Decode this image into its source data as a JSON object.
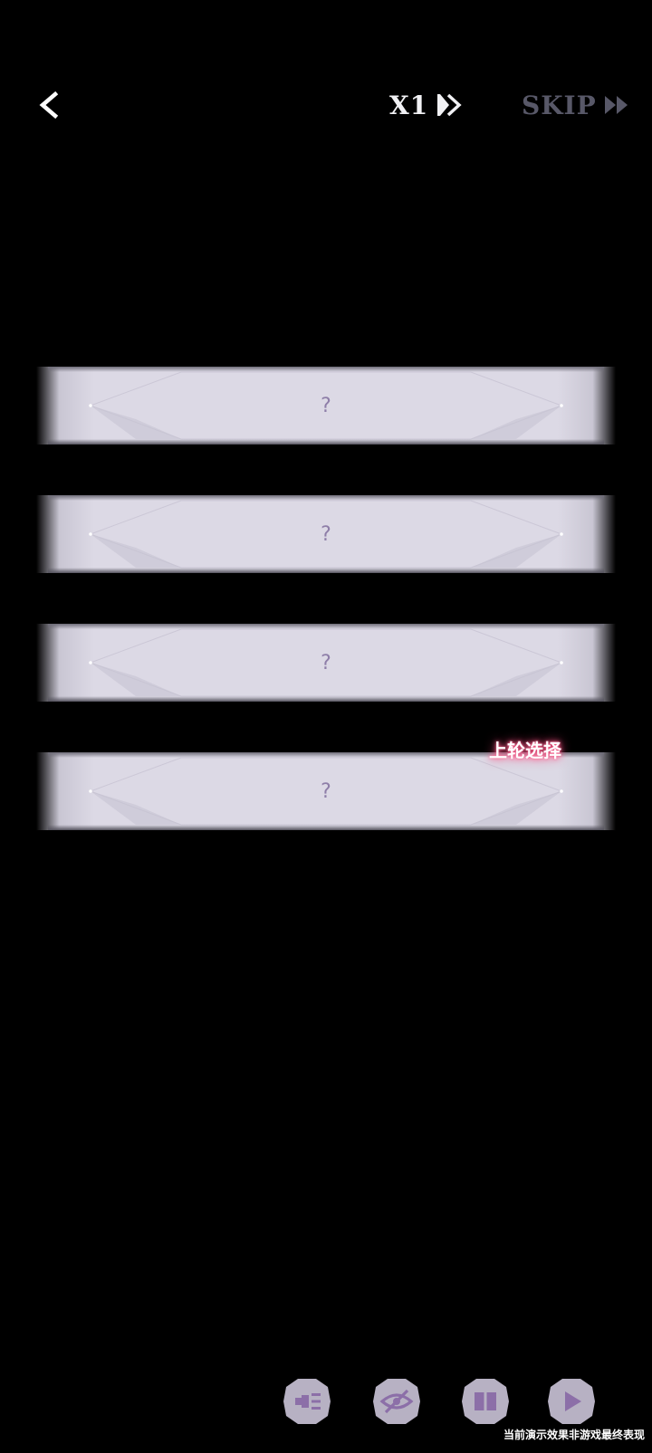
{
  "header": {
    "back_icon": "chevron-left-icon",
    "speed_label": "X1",
    "speed_icon": "double-chevron-right-icon",
    "skip_label": "SKIP",
    "skip_icon": "fast-forward-icon"
  },
  "options": [
    {
      "text": "?"
    },
    {
      "text": "?"
    },
    {
      "text": "?"
    },
    {
      "text": "?",
      "badge": "上轮选择"
    }
  ],
  "toolbar": {
    "items": [
      {
        "icon": "log-icon"
      },
      {
        "icon": "hide-eye-icon"
      },
      {
        "icon": "book-icon"
      },
      {
        "icon": "play-icon"
      }
    ]
  },
  "footer_note": "当前演示效果非游戏最终表现",
  "colors": {
    "background": "#000000",
    "option_fill": "#dcd9e5",
    "option_text": "#8e7ea8",
    "skip_text": "#585868",
    "toolbar_button": "#b7b1c3",
    "badge_glow": "#ff4a7d"
  }
}
